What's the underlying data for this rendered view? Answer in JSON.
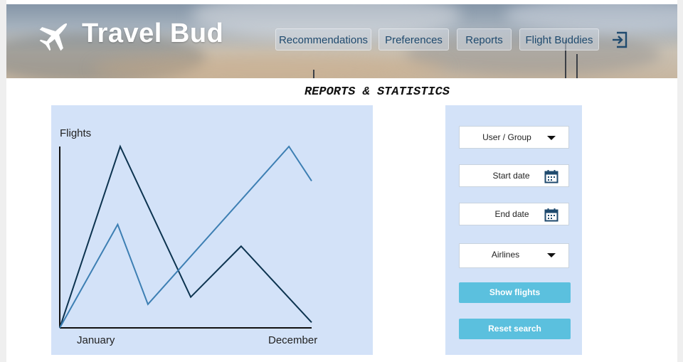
{
  "app": {
    "name": "Travel Bud",
    "logo_icon": "airplane-icon"
  },
  "nav": {
    "items": [
      {
        "label": "Recommendations"
      },
      {
        "label": "Preferences"
      },
      {
        "label": "Reports"
      },
      {
        "label": "Flight Buddies"
      }
    ],
    "logout_icon": "logout-icon"
  },
  "page": {
    "title": "REPORTS & STATISTICS"
  },
  "chart_data": {
    "type": "line",
    "ylabel": "Flights",
    "tick_labels": [
      "January",
      "December"
    ],
    "grid": false,
    "legend": "none",
    "series": [
      {
        "color": "#0d3450",
        "values": [
          [
            0,
            0
          ],
          [
            0.24,
            1.0
          ],
          [
            0.52,
            0.17
          ],
          [
            0.72,
            0.45
          ],
          [
            1.0,
            0.03
          ]
        ]
      },
      {
        "color": "#3d7fb3",
        "values": [
          [
            0,
            0
          ],
          [
            0.23,
            0.57
          ],
          [
            0.35,
            0.13
          ],
          [
            0.91,
            1.0
          ],
          [
            1.0,
            0.81
          ]
        ]
      }
    ],
    "xlim": [
      0,
      1
    ],
    "ylim": [
      0,
      1
    ]
  },
  "filters": {
    "user_group": "User / Group",
    "start_date": "Start date",
    "end_date": "End date",
    "airlines": "Airlines",
    "show_flights": "Show flights",
    "reset_search": "Reset search"
  },
  "colors": {
    "panel_bg": "#d3e2f8",
    "button_bg": "#5bc0de",
    "nav_text": "#1f4a6e"
  }
}
